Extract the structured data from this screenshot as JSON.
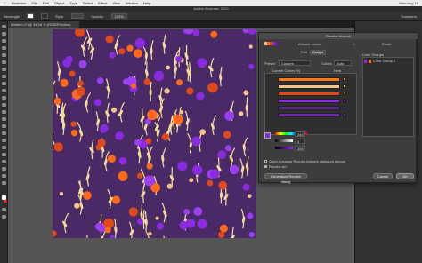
{
  "menubar": {
    "items": [
      "Illustrator",
      "File",
      "Edit",
      "Object",
      "Type",
      "Select",
      "Effect",
      "View",
      "Window",
      "Help"
    ],
    "clock": "Wed Aug 16"
  },
  "window": {
    "title": "Adobe Illustrator 2023"
  },
  "control_bar": {
    "label": "Rectangle",
    "style_label": "Style:",
    "opacity_label": "Opacity:",
    "opacity_value": "100%",
    "transform_label": "Transform"
  },
  "document": {
    "tab_label": "Untitled-1* @ 34.98 % (RGB/Preview)"
  },
  "dialog": {
    "title": "Recolor Artwork",
    "preset_name": "Artwork colors",
    "reset_label": "Reset",
    "tabs": [
      "Edit",
      "Assign"
    ],
    "active_tab": "Assign",
    "preset_label": "Preset:",
    "preset_value": "Custom",
    "colors_label": "Colors:",
    "colors_value": "Auto",
    "current_colors_label": "Current Colors (9)",
    "new_label": "New",
    "color_groups_label": "Color Groups",
    "color_group_item": "Color Group 1",
    "slider_values": [
      "244",
      "0",
      "255"
    ],
    "checkbox_advanced": "Open Advance Recolor Artwork dialog on launch",
    "checkbox_recolor": "Recolor Art",
    "generalize_button": "Generalize Recolor dialog",
    "cancel_button": "Cancel",
    "ok_button": "OK"
  },
  "colors": {
    "artboard_bg": "#4a2a66",
    "orange": "#ff6a1a",
    "red_orange": "#e04a1a",
    "peach": "#f4c48a",
    "purple": "#8a2be2",
    "violet": "#9b3ff0",
    "dark_purple": "#5a2a8a",
    "cream": "#f3dc9a",
    "panel": "#3d3d3d"
  },
  "current_color_bars": [
    "#ff7a1a",
    "#f4c48a",
    "#e04a1a",
    "#8a2be2",
    "#5a2a8a",
    "#6a2aa0"
  ],
  "new_color_boxes": [
    "#ff7a1a",
    "#f4c48a",
    "#e04a1a",
    "#8a2be2",
    "#5a2a8a",
    "#6a2aa0"
  ],
  "header_swatches": [
    "#f4c48a",
    "#ff6a1a",
    "#e04a1a",
    "#8a2be2",
    "#5a2a8a",
    "#4a2a66"
  ]
}
